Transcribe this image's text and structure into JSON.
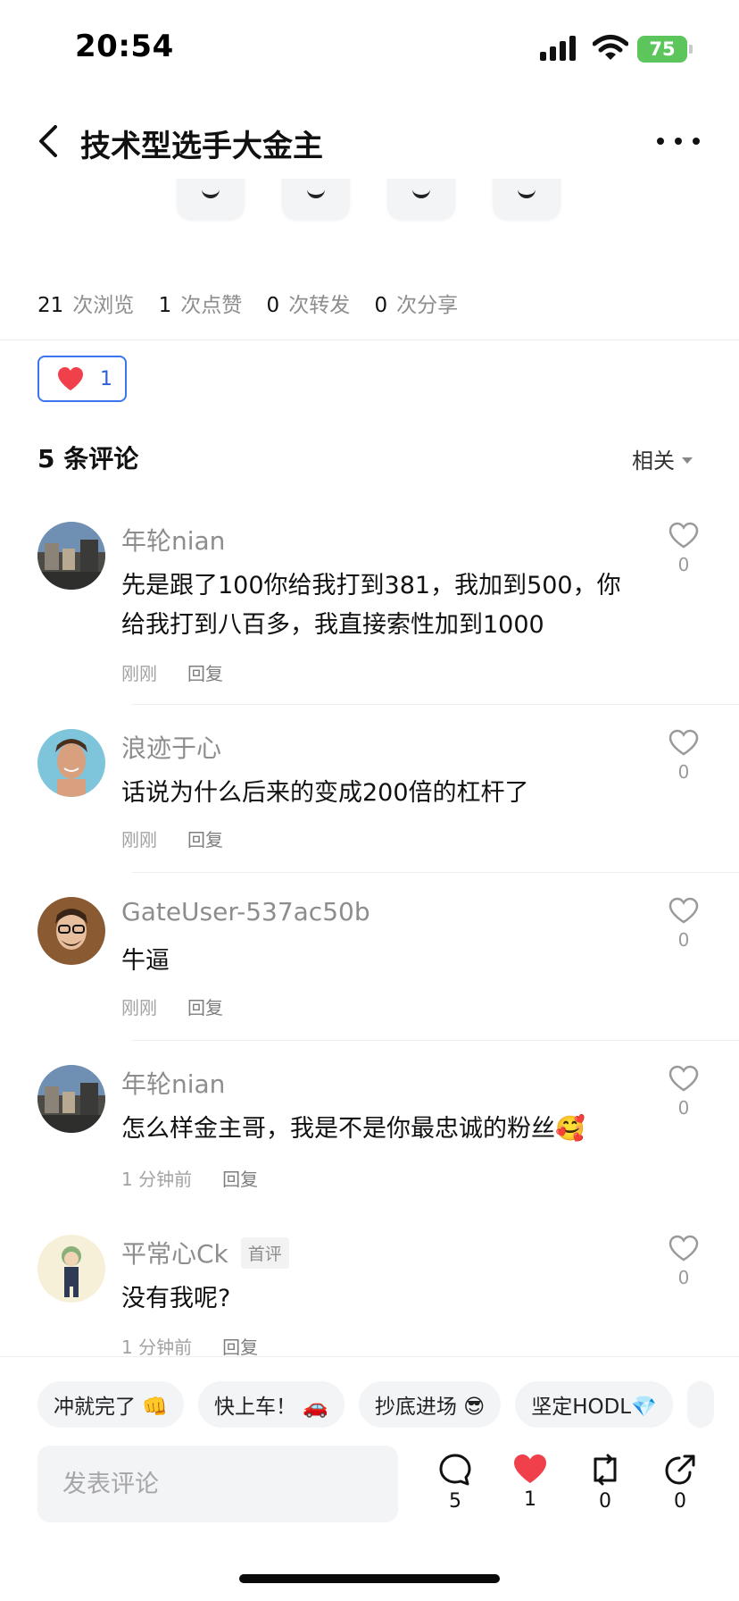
{
  "status_bar": {
    "time": "20:54",
    "battery": "75"
  },
  "header": {
    "title": "技术型选手大金主"
  },
  "share_buttons": [
    "share-option-1",
    "share-option-2",
    "share-option-3",
    "share-option-4"
  ],
  "stats": {
    "views": "21",
    "views_label": "次浏览",
    "likes": "1",
    "likes_label": "次点赞",
    "reposts": "0",
    "reposts_label": "次转发",
    "shares": "0",
    "shares_label": "次分享"
  },
  "reaction": {
    "count": "1"
  },
  "comments_section": {
    "title": "5 条评论",
    "sort": "相关"
  },
  "comments": [
    {
      "user": "年轮nian",
      "badge": "",
      "text": "先是跟了100你给我打到381，我加到500，你给我打到八百多，我直接索性加到1000",
      "time": "刚刚",
      "reply": "回复",
      "likes": "0"
    },
    {
      "user": "浪迹于心",
      "badge": "",
      "text": "话说为什么后来的变成200倍的杠杆了",
      "time": "刚刚",
      "reply": "回复",
      "likes": "0"
    },
    {
      "user": "GateUser-537ac50b",
      "badge": "",
      "text": "牛逼",
      "time": "刚刚",
      "reply": "回复",
      "likes": "0"
    },
    {
      "user": "年轮nian",
      "badge": "",
      "text": "怎么样金主哥，我是不是你最忠诚的粉丝🥰",
      "time": "1 分钟前",
      "reply": "回复",
      "likes": "0"
    },
    {
      "user": "平常心Ck",
      "badge": "首评",
      "text": "没有我呢?",
      "time": "1 分钟前",
      "reply": "回复",
      "likes": "0"
    }
  ],
  "quick_replies": [
    "冲就完了 👊",
    "快上车！ 🚗",
    "抄底进场 😎",
    "坚定HODL💎"
  ],
  "composer": {
    "placeholder": "发表评论"
  },
  "actions": {
    "comments": "5",
    "likes": "1",
    "reposts": "0",
    "shares": "0"
  },
  "colors": {
    "accent_blue": "#3c73ee",
    "heart_red": "#f0404b",
    "battery_green": "#5cc65c"
  }
}
